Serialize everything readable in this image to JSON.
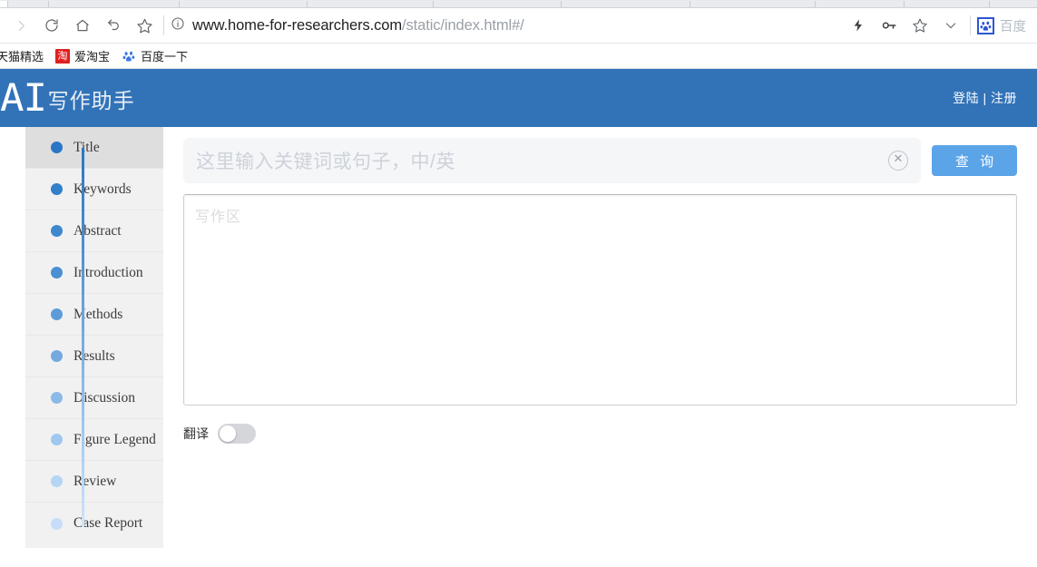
{
  "browser": {
    "toolbar": {
      "icons": [
        "forward-arrow-icon",
        "reload-icon",
        "home-icon",
        "back-curve-icon",
        "star-icon",
        "info-icon"
      ],
      "url_main": "www.home-for-researchers.com",
      "url_path": "/static/index.html#/",
      "right_icons": [
        "lightning-icon",
        "key-icon",
        "star-icon",
        "chevron-down-icon"
      ],
      "extension_label": "百度"
    },
    "bookmarks": [
      {
        "label": "天猫精选",
        "icon": ""
      },
      {
        "label": "爱淘宝",
        "icon": "淘"
      },
      {
        "label": "百度一下",
        "icon": "paw"
      }
    ]
  },
  "header": {
    "logo_mark": "AI",
    "logo_text": "写作助手",
    "auth": "登陆 | 注册"
  },
  "sidebar": {
    "items": [
      {
        "label": "Title",
        "color": "#2b76c4",
        "active": true
      },
      {
        "label": "Keywords",
        "color": "#3280c9",
        "active": false
      },
      {
        "label": "Abstract",
        "color": "#3e88ce",
        "active": false
      },
      {
        "label": "Introduction",
        "color": "#4a90d2",
        "active": false
      },
      {
        "label": "Methods",
        "color": "#5e9cd9",
        "active": false
      },
      {
        "label": "Results",
        "color": "#74aae0",
        "active": false
      },
      {
        "label": "Discussion",
        "color": "#8bb9e8",
        "active": false
      },
      {
        "label": "Figure Legend",
        "color": "#9ec8ef",
        "active": false
      },
      {
        "label": "Review",
        "color": "#b4d5f5",
        "active": false
      },
      {
        "label": "Case Report",
        "color": "#c5ddf9",
        "active": false
      }
    ]
  },
  "main": {
    "search": {
      "value": "",
      "placeholder": "这里输入关键词或句子，中/英",
      "clear_icon": "circle-x-icon",
      "button_label": "查 询",
      "button_color": "#5ba4e8"
    },
    "editor": {
      "value": "",
      "placeholder": "写作区"
    },
    "translate": {
      "label": "翻译",
      "enabled": false
    }
  }
}
